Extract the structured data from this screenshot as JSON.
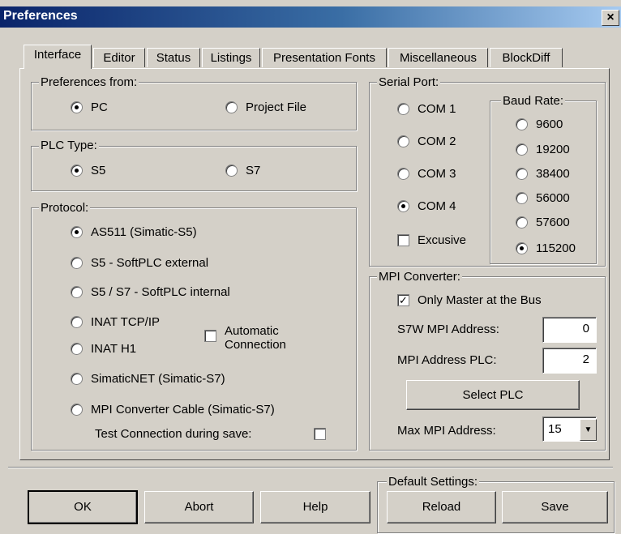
{
  "window": {
    "title": "Preferences",
    "close": "×"
  },
  "tabs": [
    "Interface",
    "Editor",
    "Status",
    "Listings",
    "Presentation Fonts",
    "Miscellaneous",
    "BlockDiff"
  ],
  "preferences_from": {
    "legend": "Preferences from:",
    "pc": "PC",
    "project_file": "Project File",
    "selected": "PC"
  },
  "plc_type": {
    "legend": "PLC Type:",
    "s5": "S5",
    "s7": "S7",
    "selected": "S5"
  },
  "protocol": {
    "legend": "Protocol:",
    "options": [
      "AS511  (Simatic-S5)",
      "S5 - SoftPLC external",
      "S5 / S7 - SoftPLC internal",
      "INAT TCP/IP",
      "INAT H1",
      "SimaticNET  (Simatic-S7)",
      "MPI Converter Cable  (Simatic-S7)"
    ],
    "selected": "AS511  (Simatic-S5)",
    "automatic_connection_line1": "Automatic",
    "automatic_connection_line2": "Connection",
    "automatic_connection_checked": false,
    "test_connection": "Test Connection during save:",
    "test_connection_checked": false
  },
  "serial_port": {
    "legend": "Serial Port:",
    "ports": [
      "COM 1",
      "COM 2",
      "COM 3",
      "COM 4"
    ],
    "selected": "COM 4",
    "exclusive": "Excusive",
    "exclusive_checked": false
  },
  "baud_rate": {
    "legend": "Baud Rate:",
    "rates": [
      "9600",
      "19200",
      "38400",
      "56000",
      "57600",
      "115200"
    ],
    "selected": "115200"
  },
  "mpi_converter": {
    "legend": "MPI Converter:",
    "only_master": "Only Master at the Bus",
    "only_master_checked": true,
    "s7w_label": "S7W MPI Address:",
    "s7w_value": "0",
    "plc_label": "MPI Address PLC:",
    "plc_value": "2",
    "select_plc": "Select PLC",
    "max_label": "Max MPI Address:",
    "max_value": "15"
  },
  "default_settings": {
    "legend": "Default Settings:",
    "reload": "Reload",
    "save": "Save"
  },
  "buttons": {
    "ok": "OK",
    "abort": "Abort",
    "help": "Help"
  },
  "colors": {
    "titlebar_start": "#0a246a",
    "face": "#d4d0c8"
  }
}
